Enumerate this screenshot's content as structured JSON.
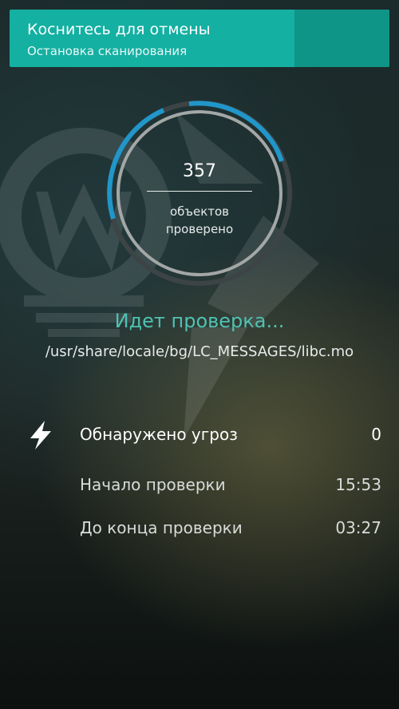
{
  "banner": {
    "title": "Коснитесь для отмены",
    "subtitle": "Остановка сканирования"
  },
  "scan": {
    "count": "357",
    "caption_line1": "объектов",
    "caption_line2": "проверено",
    "status": "Идет проверка...",
    "current_file": "/usr/share/locale/bg/LC_MESSAGES/libc.mo"
  },
  "stats": {
    "threats_label": "Обнаружено угроз",
    "threats_value": "0",
    "start_label": "Начало проверки",
    "start_value": "15:53",
    "remaining_label": "До конца проверки",
    "remaining_value": "03:27"
  },
  "icons": {
    "threats": "lightning-bolt-icon"
  },
  "colors": {
    "banner": "#14b0a2",
    "banner_side": "#0f9488",
    "accent_blue": "#2196c9",
    "status_teal": "#4fc1b2"
  }
}
